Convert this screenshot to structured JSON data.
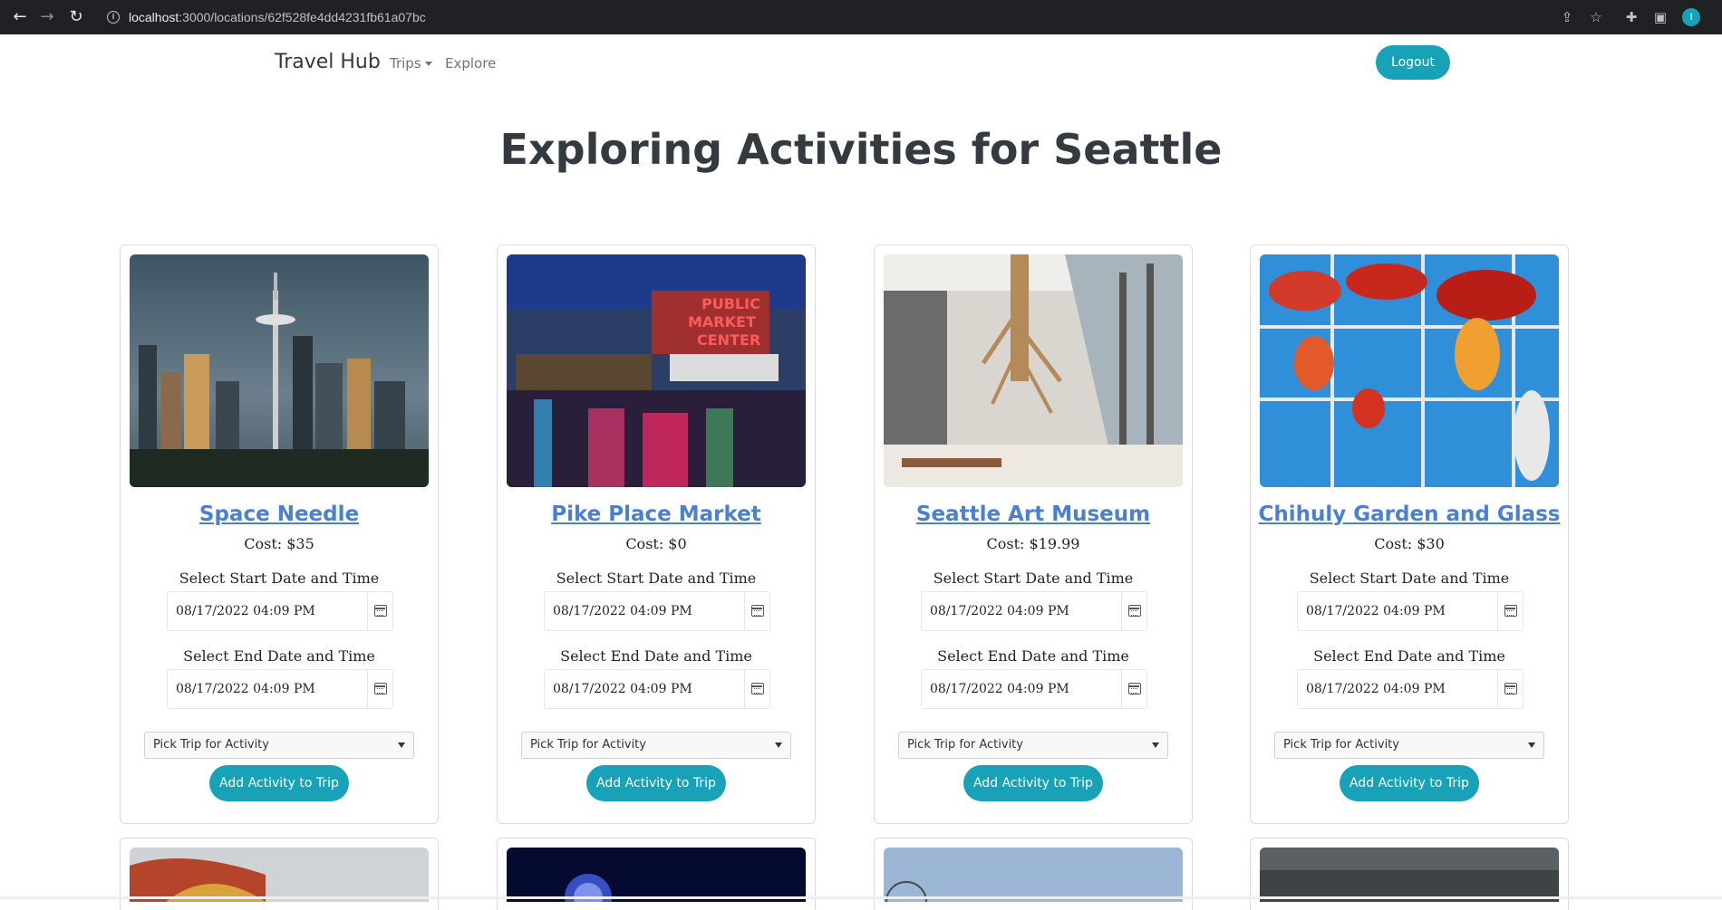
{
  "browser": {
    "url_host": "localhost",
    "url_path": ":3000/locations/62f528fe4dd4231fb61a07bc",
    "profile_initial": "I"
  },
  "navbar": {
    "brand": "Travel Hub",
    "trips_label": "Trips",
    "explore_label": "Explore",
    "logout_label": "Logout"
  },
  "page": {
    "title": "Exploring Activities for Seattle"
  },
  "cards": [
    {
      "name": "Space Needle",
      "cost": "Cost: $35",
      "start_label": "Select Start Date and Time",
      "start_value": "08/17/2022 04:09 PM",
      "end_label": "Select End Date and Time",
      "end_value": "08/17/2022 04:09 PM",
      "trip_select": "Pick Trip for Activity",
      "add_button": "Add Activity to Trip"
    },
    {
      "name": "Pike Place Market",
      "cost": "Cost: $0",
      "start_label": "Select Start Date and Time",
      "start_value": "08/17/2022 04:09 PM",
      "end_label": "Select End Date and Time",
      "end_value": "08/17/2022 04:09 PM",
      "trip_select": "Pick Trip for Activity",
      "add_button": "Add Activity to Trip"
    },
    {
      "name": "Seattle Art Museum",
      "cost": "Cost: $19.99",
      "start_label": "Select Start Date and Time",
      "start_value": "08/17/2022 04:09 PM",
      "end_label": "Select End Date and Time",
      "end_value": "08/17/2022 04:09 PM",
      "trip_select": "Pick Trip for Activity",
      "add_button": "Add Activity to Trip"
    },
    {
      "name": "Chihuly Garden and Glass",
      "cost": "Cost: $30",
      "start_label": "Select Start Date and Time",
      "start_value": "08/17/2022 04:09 PM",
      "end_label": "Select End Date and Time",
      "end_value": "08/17/2022 04:09 PM",
      "trip_select": "Pick Trip for Activity",
      "add_button": "Add Activity to Trip"
    }
  ],
  "icons": {
    "back": "back-arrow-icon",
    "forward": "forward-arrow-icon",
    "reload": "reload-icon",
    "site_info": "info-icon",
    "share": "share-icon",
    "bookmark": "star-icon",
    "extensions": "puzzle-icon",
    "sidepanel": "side-panel-icon",
    "calendar": "calendar-icon",
    "dropdown": "chevron-down-icon"
  },
  "colors": {
    "accent": "#17a2b8",
    "link": "#4a7fd1",
    "heading": "#343a40",
    "browser_chrome": "#202124"
  }
}
